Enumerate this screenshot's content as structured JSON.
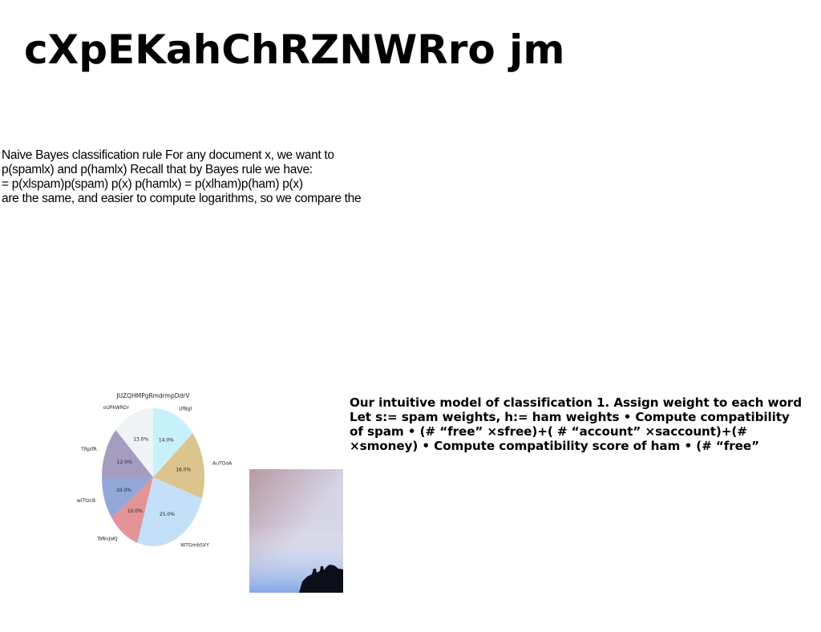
{
  "document": {
    "title": "cXpEKahChRZNWRro jm",
    "paragraph_lines": [
      "Naive Bayes classification rule For any document x, we want to",
      "p(spamlx) and p(hamlx) Recall that by Bayes rule we have:",
      "= p(xlspam)p(spam) p(x) p(hamlx) = p(xlham)p(ham) p(x)",
      "are the same, and easier to compute logarithms, so we compare the"
    ],
    "bold_lines": [
      "Our intuitive model of classification 1. Assign weight to each word",
      "Let s:= spam weights, h:= ham weights • Compute compatibility",
      "of spam • (# “free” ×sfree)+( # “account” ×saccount)+(#",
      "×smoney) • Compute compatibility score of ham • (# “free”"
    ]
  },
  "chart_data": {
    "type": "pie",
    "title": "JUZQHMPgRmdrmpDdrV",
    "slices": [
      {
        "label": "UfBgl",
        "value": 14.0,
        "text": "14.0%",
        "color": "#c9f1fb"
      },
      {
        "label": "AuTOoA",
        "value": 16.0,
        "text": "16.0%",
        "color": "#dcc48e"
      },
      {
        "label": "WTGmbSVY",
        "value": 25.0,
        "text": "25.0%",
        "color": "#c3e0f8"
      },
      {
        "label": "TaNvJaKJ",
        "value": 10.0,
        "text": "10.0%",
        "color": "#e29498"
      },
      {
        "label": "wITtzcB",
        "value": 10.0,
        "text": "10.0%",
        "color": "#94a7d9"
      },
      {
        "label": "TRpifR",
        "value": 12.0,
        "text": "12.0%",
        "color": "#a59dbf"
      },
      {
        "label": "oUPkWRDr",
        "value": 13.0,
        "text": "13.0%",
        "color": "#eff4f7"
      }
    ]
  },
  "photo": {
    "sky_top": "#b79aa3",
    "sky_mid": "#d6d5e6",
    "sky_bottom": "#7aa3e6",
    "silhouette": "#0d0f18"
  }
}
